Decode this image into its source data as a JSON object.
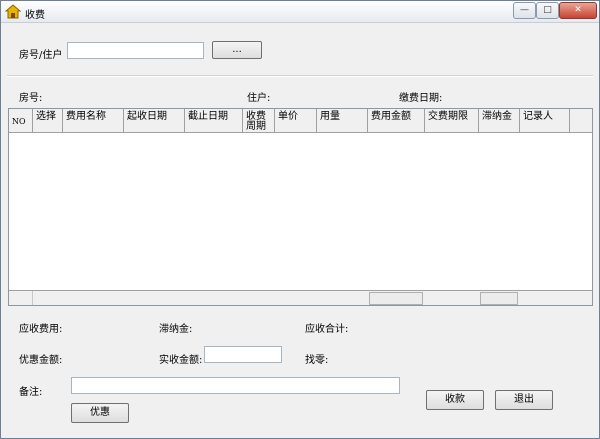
{
  "window": {
    "title": "收费",
    "min_glyph": "—",
    "max_glyph": "□",
    "close_glyph": "✕"
  },
  "search": {
    "label": "房号/住户",
    "value": "",
    "browse_label": "..."
  },
  "info": {
    "room_label": "房号:",
    "resident_label": "住户:",
    "pay_date_label": "缴费日期:"
  },
  "table": {
    "columns": [
      "NO",
      "选择",
      "费用名称",
      "起收日期",
      "截止日期",
      "收费周期",
      "单价",
      "用量",
      "费用金额",
      "交费期限",
      "滞纳金",
      "记录人"
    ],
    "rows": []
  },
  "summary": {
    "receivable_label": "应收费用:",
    "late_fee_label": "滞纳金:",
    "total_label": "应收合计:",
    "discount_label": "优惠金额:",
    "actual_label": "实收金额:",
    "actual_value": "",
    "change_label": "找零:",
    "remark_label": "备注:",
    "remark_value": ""
  },
  "buttons": {
    "discount": "优惠",
    "collect": "收款",
    "exit": "退出"
  }
}
